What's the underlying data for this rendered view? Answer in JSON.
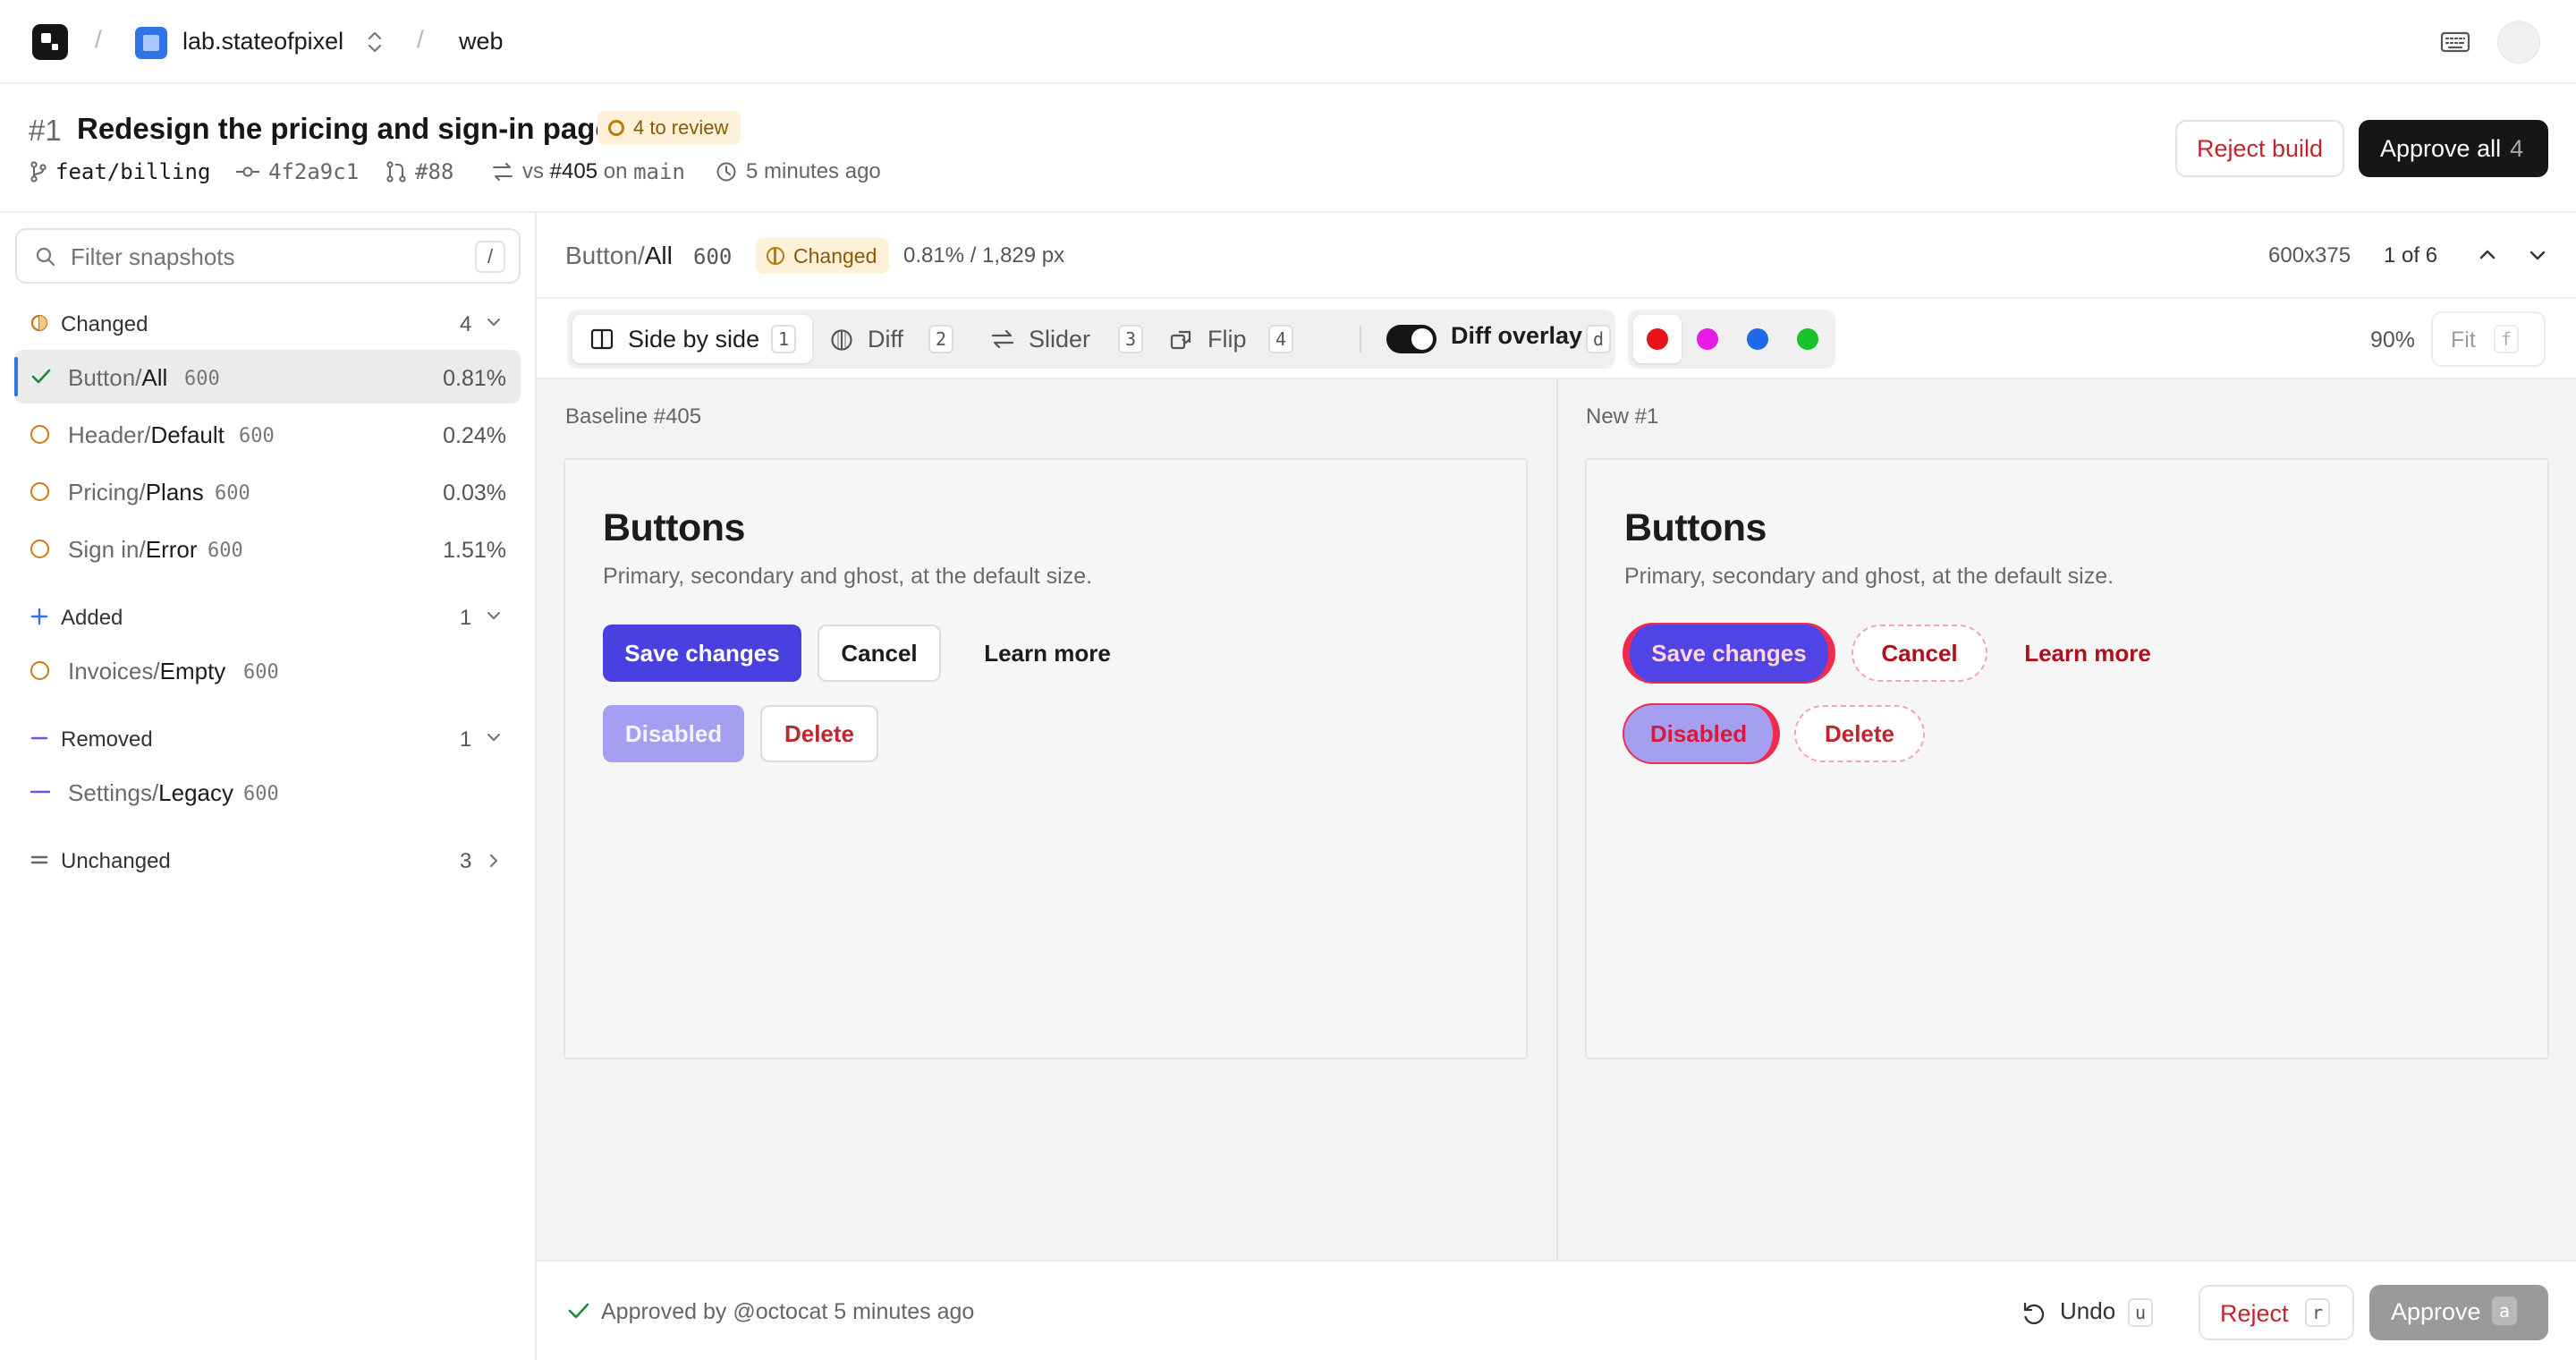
{
  "topbar": {
    "project": "lab.stateofpixel",
    "repo": "web",
    "separator": "/"
  },
  "build": {
    "number": "#1",
    "title": "Redesign the pricing and sign-in pages",
    "review_badge": "4 to review",
    "branch": "feat/billing",
    "commit": "4f2a9c1",
    "pr": "#88",
    "compare_prefix": "vs",
    "compare_build": "#405",
    "compare_on": "on",
    "compare_branch": "main",
    "time": "5 minutes ago",
    "reject_label": "Reject build",
    "approve_all_label": "Approve all",
    "approve_all_count": "4"
  },
  "sidebar": {
    "filter_placeholder": "Filter snapshots",
    "filter_shortcut": "/",
    "groups": [
      {
        "label": "Changed",
        "count": "4",
        "color": "#c97a18"
      },
      {
        "label": "Added",
        "count": "1",
        "color": "#2f74e6"
      },
      {
        "label": "Removed",
        "count": "1",
        "color": "#7a4de0"
      },
      {
        "label": "Unchanged",
        "count": "3",
        "color": "#666666"
      }
    ],
    "changed": [
      {
        "prefix": "Button/",
        "name": "All",
        "width": "600",
        "pct": "0.81%",
        "state": "approved"
      },
      {
        "prefix": "Header/",
        "name": "Default",
        "width": "600",
        "pct": "0.24%",
        "state": "pending"
      },
      {
        "prefix": "Pricing/",
        "name": "Plans",
        "width": "600",
        "pct": "0.03%",
        "state": "pending"
      },
      {
        "prefix": "Sign in/",
        "name": "Error",
        "width": "600",
        "pct": "1.51%",
        "state": "pending"
      }
    ],
    "added": [
      {
        "prefix": "Invoices/",
        "name": "Empty",
        "width": "600"
      }
    ],
    "removed": [
      {
        "prefix": "Settings/",
        "name": "Legacy",
        "width": "600"
      }
    ]
  },
  "snapshot": {
    "prefix": "Button/",
    "name": "All",
    "width": "600",
    "status": "Changed",
    "diff": "0.81% / 1,829 px",
    "dims": "600x375",
    "position": "1 of 6"
  },
  "toolbar": {
    "modes": [
      {
        "label": "Side by side",
        "key": "1",
        "icon": "columns-icon"
      },
      {
        "label": "Diff",
        "key": "2",
        "icon": "diff-icon"
      },
      {
        "label": "Slider",
        "key": "3",
        "icon": "arrows-horizontal-icon"
      },
      {
        "label": "Flip",
        "key": "4",
        "icon": "flip-icon"
      }
    ],
    "overlay_label": "Diff overlay",
    "overlay_key": "d",
    "overlay_on": true,
    "overlay_colors": [
      "#e8141a",
      "#e61be8",
      "#1f6ae8",
      "#18c22a"
    ],
    "zoom": "90%",
    "fit_label": "Fit",
    "fit_key": "f"
  },
  "panes": {
    "baseline_label": "Baseline #405",
    "new_label": "New #1",
    "heading": "Buttons",
    "subheading": "Primary, secondary and ghost, at the default size.",
    "buttons": {
      "primary": "Save changes",
      "secondary": "Cancel",
      "ghost": "Learn more",
      "disabled": "Disabled",
      "danger": "Delete"
    }
  },
  "actionbar": {
    "approved_text": "Approved by @octocat 5 minutes ago",
    "undo_label": "Undo",
    "undo_key": "u",
    "reject_label": "Reject",
    "reject_key": "r",
    "approve_label": "Approve",
    "approve_key": "a"
  }
}
